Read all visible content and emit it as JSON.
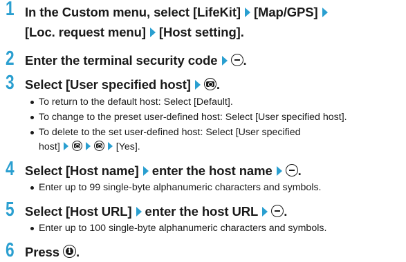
{
  "steps": [
    {
      "number": "1",
      "line1": "In the Custom menu, select [LifeKit]",
      "part2": "[Map/GPS]",
      "line2a": "[Loc. request menu]",
      "line2b": "[Host setting]."
    },
    {
      "number": "2",
      "text": "Enter the terminal security code"
    },
    {
      "number": "3",
      "text": "Select [User specified host]"
    },
    {
      "number": "4",
      "part1": "Select [Host name]",
      "part2": "enter the host name"
    },
    {
      "number": "5",
      "part1": "Select [Host URL]",
      "part2": "enter the host URL"
    },
    {
      "number": "6",
      "text": "Press"
    }
  ],
  "bullets": {
    "step3": [
      "To return to the default host: Select [Default].",
      "To change to the preset user-defined host: Select [User specified host].",
      "To delete to the set user-defined host: Select [User specified",
      "host]",
      "[Yes]."
    ],
    "step4": "Enter up to 99 single-byte alphanumeric characters and symbols.",
    "step5": "Enter up to 100 single-byte alphanumeric characters and symbols."
  },
  "icons": {
    "arrow": "triangle-right-icon",
    "minus_key": "minus-key-icon",
    "camera_key": "camera-key-icon",
    "info_key": "info-key-icon"
  },
  "colors": {
    "accent": "#2a9fd0",
    "text": "#1a1a1a"
  },
  "period": "."
}
